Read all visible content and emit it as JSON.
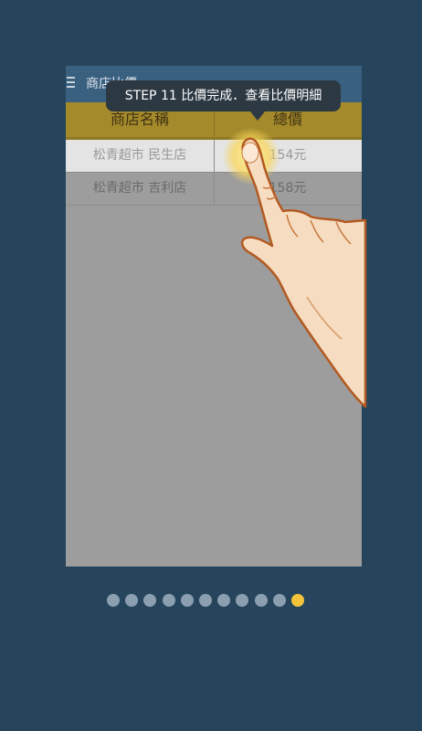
{
  "appbar": {
    "title": "商店比價",
    "menu_icon": "hamburger-menu-icon"
  },
  "table": {
    "headers": [
      "商店名稱",
      "總價"
    ],
    "rows": [
      {
        "store": "松青超市 民生店",
        "total": "154元"
      },
      {
        "store": "松青超市 吉利店",
        "total": "158元"
      }
    ]
  },
  "tooltip": {
    "text": "STEP 11  比價完成．查看比價明細"
  },
  "pager": {
    "count": 11,
    "active_index": 10,
    "active_color": "#f3c43a",
    "inactive_color": "#8c9fb0"
  },
  "hand_icon": "pointing-hand-icon"
}
